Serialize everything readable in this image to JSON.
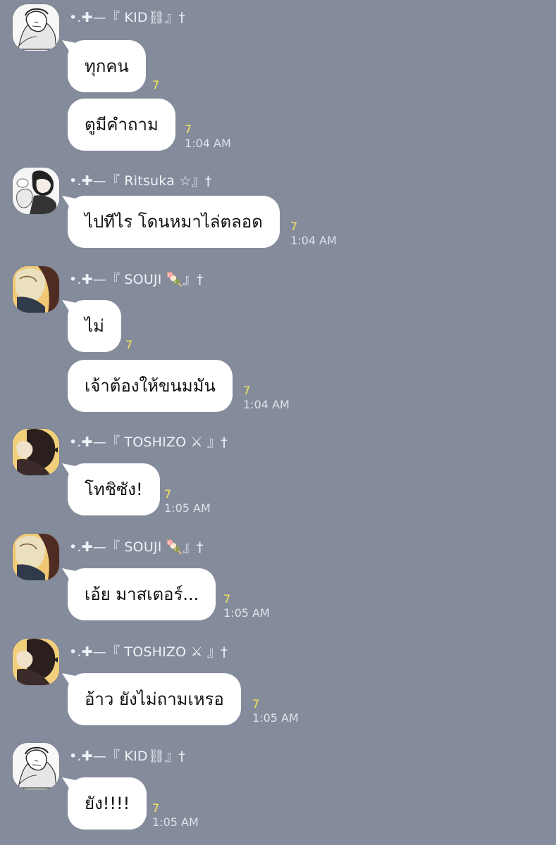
{
  "conversation": {
    "messages": [
      {
        "sender": "•.✚—『 KID⛓』†",
        "avatar_icon": "kid-avatar",
        "bubbles": [
          {
            "text": "ทุกคน",
            "read": "7"
          },
          {
            "text": "ตูมีคำถาม",
            "read": "7",
            "time": "1:04 AM"
          }
        ]
      },
      {
        "sender": "•.✚—『 Ritsuka ☆』†",
        "avatar_icon": "ritsuka-avatar",
        "bubbles": [
          {
            "text": "ไปทีไร โดนหมาไล่ตลอด",
            "read": "7",
            "time": "1:04 AM"
          }
        ]
      },
      {
        "sender": "•.✚—『 SOUJI 🍡』†",
        "avatar_icon": "souji-avatar",
        "bubbles": [
          {
            "text": "ไม่",
            "read": "7"
          },
          {
            "text": "เจ้าต้องให้ขนมมัน",
            "read": "7",
            "time": "1:04 AM"
          }
        ]
      },
      {
        "sender": "•.✚—『 TOSHIZO ⚔ 』†",
        "avatar_icon": "toshizo-avatar",
        "bubbles": [
          {
            "text": "โทชิซัง!",
            "read": "7",
            "time": "1:05 AM"
          }
        ]
      },
      {
        "sender": "•.✚—『 SOUJI 🍡』†",
        "avatar_icon": "souji-avatar",
        "bubbles": [
          {
            "text": "เอ้ย มาสเตอร์...",
            "read": "7",
            "time": "1:05 AM"
          }
        ]
      },
      {
        "sender": "•.✚—『 TOSHIZO ⚔ 』†",
        "avatar_icon": "toshizo-avatar",
        "bubbles": [
          {
            "text": "อ้าว ยังไม่ถามเหรอ",
            "read": "7",
            "time": "1:05 AM"
          }
        ]
      },
      {
        "sender": "•.✚—『 KID⛓』†",
        "avatar_icon": "kid-avatar",
        "bubbles": [
          {
            "text": "ยัง!!!!",
            "read": "7",
            "time": "1:05 AM"
          }
        ]
      }
    ]
  },
  "theme": {
    "background": "#848b9b",
    "bubble": "#ffffff",
    "text": "#111111",
    "read_receipt": "#f6e75b",
    "meta_text": "#dfe3ea"
  }
}
